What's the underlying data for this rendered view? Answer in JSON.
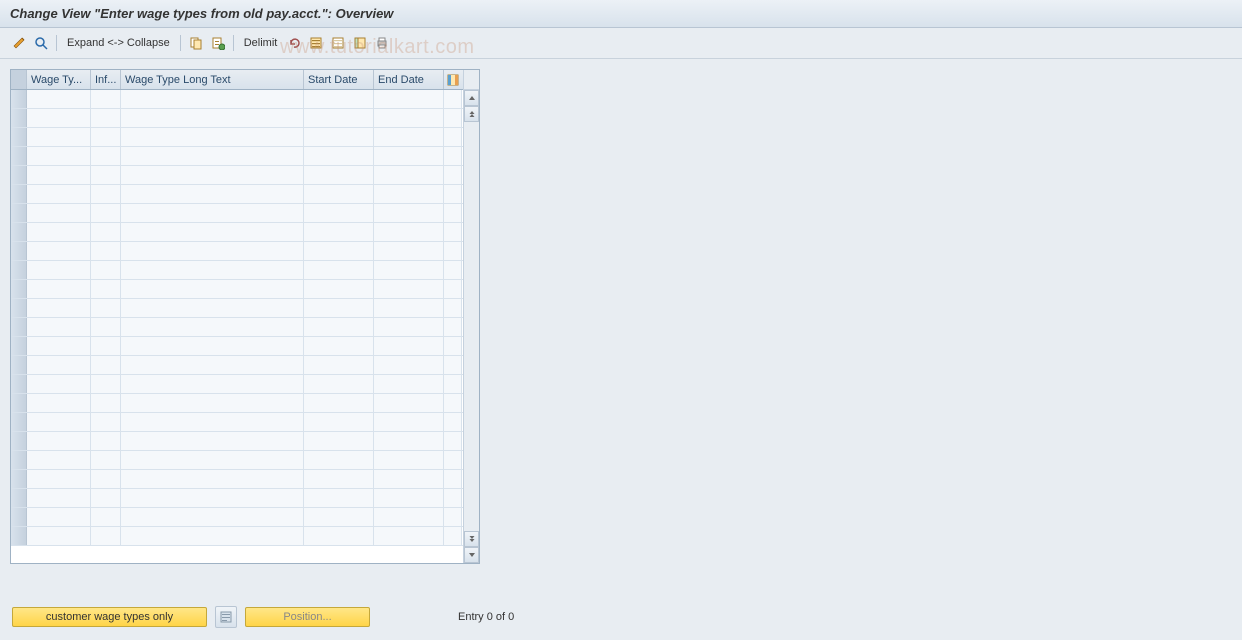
{
  "title": "Change View \"Enter wage types from old pay.acct.\": Overview",
  "toolbar": {
    "expand_label": "Expand <-> Collapse",
    "delimit_label": "Delimit"
  },
  "table": {
    "headers": {
      "wage_type": "Wage Ty...",
      "inf": "Inf...",
      "long_text": "Wage Type Long Text",
      "start_date": "Start Date",
      "end_date": "End Date"
    },
    "row_count": 24,
    "rows": []
  },
  "footer": {
    "customer_btn": "customer wage types only",
    "position_btn": "Position...",
    "entry_text": "Entry 0 of 0"
  },
  "watermark": "www.tutorialkart.com"
}
